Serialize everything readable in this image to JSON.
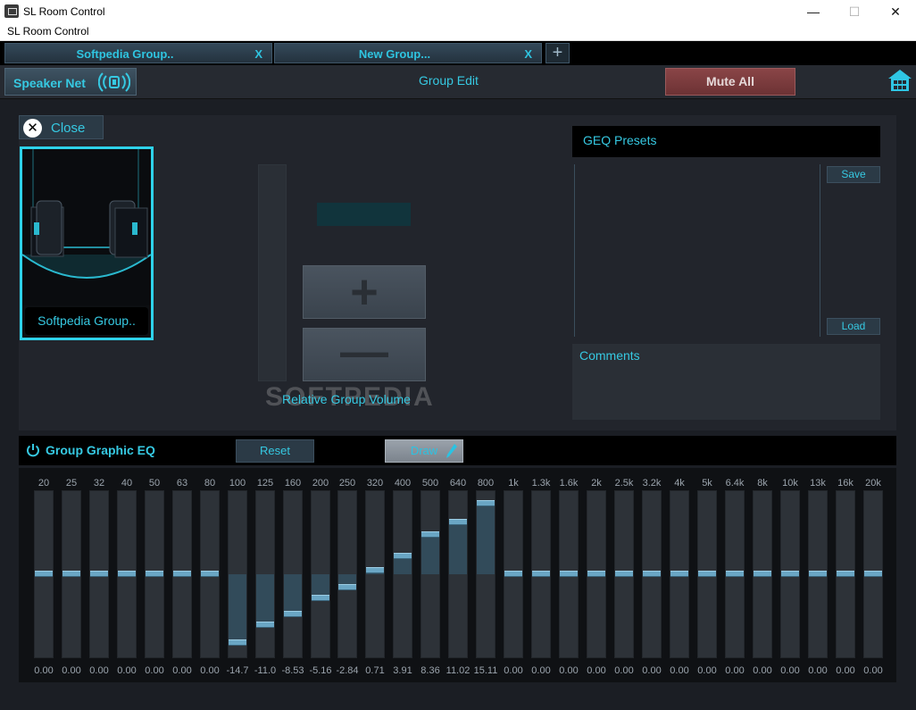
{
  "window": {
    "title": "SL Room Control",
    "menu_label": "SL Room Control",
    "minimize": "—",
    "maximize": "☐",
    "close": "✕"
  },
  "tabs": [
    {
      "label": "Softpedia Group..",
      "close": "X"
    },
    {
      "label": "New Group...",
      "close": "X"
    }
  ],
  "tab_add": "+",
  "header": {
    "speaker_net_label": "Speaker Net",
    "center_title": "Group Edit",
    "mute_all_label": "Mute All"
  },
  "group_panel": {
    "close_label": "Close",
    "close_glyph": "✕",
    "card_label": "Softpedia Group..",
    "volume_label": "Relative Group Volume",
    "plus": "+",
    "minus": "—",
    "watermark": "SOFTPEDIA"
  },
  "presets": {
    "title": "GEQ Presets",
    "save_label": "Save",
    "load_label": "Load",
    "comments_label": "Comments"
  },
  "eq": {
    "title": "Group Graphic EQ",
    "reset_label": "Reset",
    "draw_label": "Draw",
    "range_db": 18,
    "bands": [
      {
        "freq": "20",
        "value": "0.00",
        "gain": 0
      },
      {
        "freq": "25",
        "value": "0.00",
        "gain": 0
      },
      {
        "freq": "32",
        "value": "0.00",
        "gain": 0
      },
      {
        "freq": "40",
        "value": "0.00",
        "gain": 0
      },
      {
        "freq": "50",
        "value": "0.00",
        "gain": 0
      },
      {
        "freq": "63",
        "value": "0.00",
        "gain": 0
      },
      {
        "freq": "80",
        "value": "0.00",
        "gain": 0
      },
      {
        "freq": "100",
        "value": "-14.7",
        "gain": -14.7
      },
      {
        "freq": "125",
        "value": "-11.0",
        "gain": -11.0
      },
      {
        "freq": "160",
        "value": "-8.53",
        "gain": -8.53
      },
      {
        "freq": "200",
        "value": "-5.16",
        "gain": -5.16
      },
      {
        "freq": "250",
        "value": "-2.84",
        "gain": -2.84
      },
      {
        "freq": "320",
        "value": "0.71",
        "gain": 0.71
      },
      {
        "freq": "400",
        "value": "3.91",
        "gain": 3.91
      },
      {
        "freq": "500",
        "value": "8.36",
        "gain": 8.36
      },
      {
        "freq": "640",
        "value": "11.02",
        "gain": 11.02
      },
      {
        "freq": "800",
        "value": "15.11",
        "gain": 15.11
      },
      {
        "freq": "1k",
        "value": "0.00",
        "gain": 0
      },
      {
        "freq": "1.3k",
        "value": "0.00",
        "gain": 0
      },
      {
        "freq": "1.6k",
        "value": "0.00",
        "gain": 0
      },
      {
        "freq": "2k",
        "value": "0.00",
        "gain": 0
      },
      {
        "freq": "2.5k",
        "value": "0.00",
        "gain": 0
      },
      {
        "freq": "3.2k",
        "value": "0.00",
        "gain": 0
      },
      {
        "freq": "4k",
        "value": "0.00",
        "gain": 0
      },
      {
        "freq": "5k",
        "value": "0.00",
        "gain": 0
      },
      {
        "freq": "6.4k",
        "value": "0.00",
        "gain": 0
      },
      {
        "freq": "8k",
        "value": "0.00",
        "gain": 0
      },
      {
        "freq": "10k",
        "value": "0.00",
        "gain": 0
      },
      {
        "freq": "13k",
        "value": "0.00",
        "gain": 0
      },
      {
        "freq": "16k",
        "value": "0.00",
        "gain": 0
      },
      {
        "freq": "20k",
        "value": "0.00",
        "gain": 0
      }
    ]
  },
  "colors": {
    "accent": "#34c6dc",
    "mute": "#7a3c3e",
    "card_border": "#2ed2ea"
  }
}
